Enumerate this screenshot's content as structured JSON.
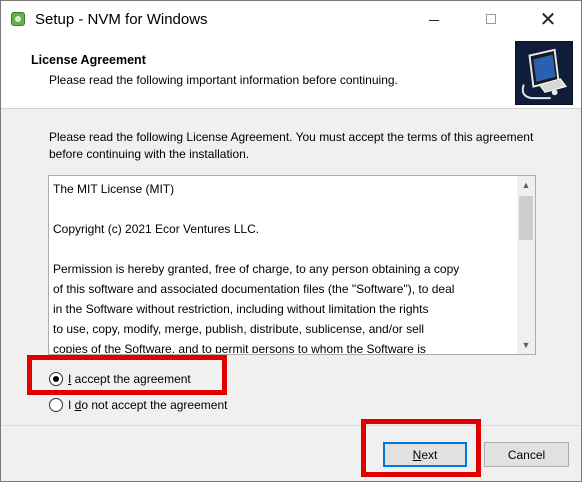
{
  "window": {
    "title": "Setup - NVM for Windows",
    "close_glyph": "✕"
  },
  "header": {
    "title": "License Agreement",
    "subtitle": "Please read the following important information before continuing."
  },
  "body": {
    "intro": "Please read the following License Agreement. You must accept the terms of this agreement before continuing with the installation."
  },
  "license": {
    "title_line": "The MIT License (MIT)",
    "copyright_line": "Copyright (c) 2021 Ecor Ventures LLC.",
    "permission_text": "Permission is hereby granted, free of charge, to any person obtaining a copy\nof this software and associated documentation files (the \"Software\"), to deal\nin the Software without restriction, including without limitation the rights\nto use, copy, modify, merge, publish, distribute, sublicense, and/or sell\ncopies of the Software, and to permit persons to whom the Software is"
  },
  "options": {
    "accept": {
      "prefix": "",
      "mnemonic": "I",
      "rest": " accept the agreement",
      "selected": true
    },
    "decline": {
      "prefix": "I ",
      "mnemonic": "d",
      "rest": "o not accept the agreement",
      "selected": false
    }
  },
  "buttons": {
    "next": {
      "mnemonic": "N",
      "rest": "ext"
    },
    "cancel": "Cancel"
  },
  "colors": {
    "highlight": "#e00000",
    "focus_border": "#0078d7"
  },
  "icons": {
    "scroll_up": "▲",
    "scroll_down": "▼"
  }
}
